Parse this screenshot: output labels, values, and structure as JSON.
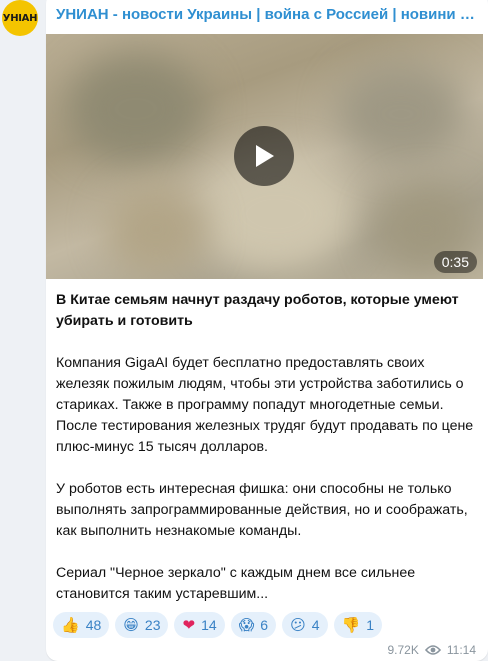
{
  "channel": {
    "avatar_text": "УНІАН",
    "name": "УНИАН - новости Украины | война с Россией | новини України | війна з Росією"
  },
  "video": {
    "duration": "0:35"
  },
  "post": {
    "headline": "В Китае семьям начнут раздачу роботов, которые умеют убирать и готовить",
    "paragraph1": "Компания GigaAI будет бесплатно предоставлять своих железяк пожилым людям, чтобы эти устройства заботились о стариках. Также в программу попадут многодетные семьи. После тестирования железных трудяг будут продавать по цене плюс-минус 15 тысяч долларов.",
    "paragraph2": "У роботов есть интересная фишка: они способны не только выполнять запрограммированные действия, но и соображать, как выполнить незнакомые команды.",
    "paragraph3": "Сериал \"Черное зеркало\" с каждым днем все сильнее становится таким устаревшим..."
  },
  "reactions": [
    {
      "icon": "thumbs-up",
      "emoji": "👍",
      "count": "48"
    },
    {
      "icon": "grinning-face",
      "emoji": "😁",
      "count": "23"
    },
    {
      "icon": "red-heart",
      "emoji": "❤",
      "count": "14"
    },
    {
      "icon": "screaming-face",
      "emoji": "😱",
      "count": "6"
    },
    {
      "icon": "confused-face",
      "emoji": "😕",
      "count": "4"
    },
    {
      "icon": "thumbs-down",
      "emoji": "👎",
      "count": "1"
    }
  ],
  "meta": {
    "views": "9.72K",
    "time": "11:14"
  },
  "colors": {
    "accent": "#2f8fd1",
    "reaction_bg": "#e5f0fb",
    "avatar_bg": "#f4c400"
  }
}
